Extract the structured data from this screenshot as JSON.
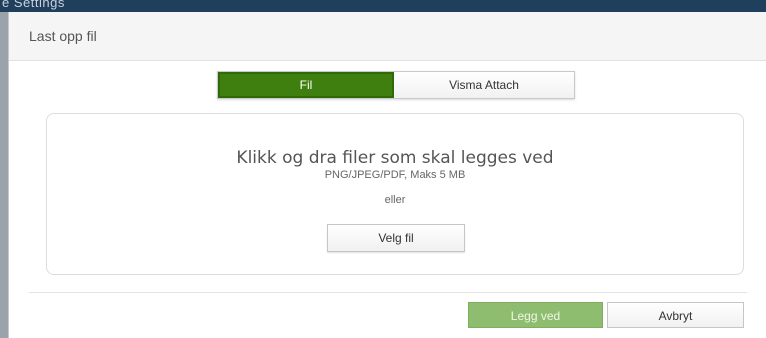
{
  "background": {
    "menu_fragment": "e   Settings"
  },
  "dialog": {
    "title": "Last opp fil",
    "tabs": [
      {
        "label": "Fil",
        "active": true
      },
      {
        "label": "Visma Attach",
        "active": false
      }
    ],
    "dropzone": {
      "heading": "Klikk og dra filer som skal legges ved",
      "formats": "PNG/JPEG/PDF, Maks 5 MB",
      "or_text": "eller",
      "choose_button": "Velg fil"
    },
    "footer": {
      "primary_button": "Legg ved",
      "secondary_button": "Avbryt"
    }
  },
  "colors": {
    "accent_green": "#3f7f10",
    "disabled_green": "#8fbd6f",
    "header_bg": "#f5f5f5"
  }
}
